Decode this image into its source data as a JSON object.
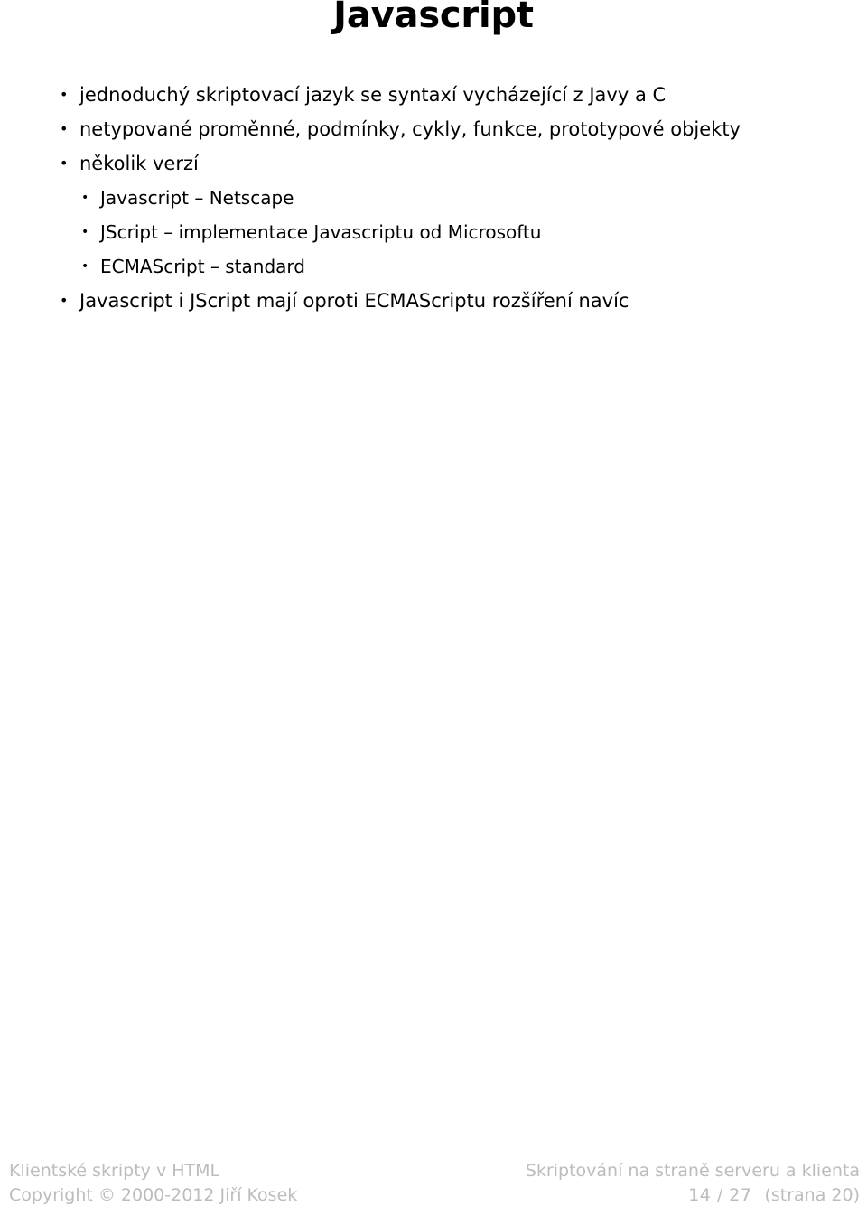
{
  "slide": {
    "title": "Javascript",
    "bullets": [
      {
        "level": 1,
        "marker": "•",
        "text": "jednoduchý skriptovací jazyk se syntaxí vycházející z Javy a C"
      },
      {
        "level": 1,
        "marker": "•",
        "text": "netypované proměnné, podmínky, cykly, funkce, prototypové objekty"
      },
      {
        "level": 1,
        "marker": "•",
        "text": "několik verzí"
      },
      {
        "level": 2,
        "marker": "•",
        "text": "Javascript – Netscape"
      },
      {
        "level": 2,
        "marker": "•",
        "text": "JScript – implementace Javascriptu od Microsoftu"
      },
      {
        "level": 2,
        "marker": "•",
        "text": "ECMAScript – standard"
      },
      {
        "level": 1,
        "marker": "•",
        "text": "Javascript i JScript mají oproti ECMAScriptu rozšíření navíc"
      }
    ]
  },
  "footer": {
    "left_line1": "Klientské skripty v HTML",
    "left_line2": "Copyright © 2000-2012 Jiří Kosek",
    "right_line1": "Skriptování na straně serveru a klienta",
    "right_page": "14 / 27",
    "right_strana": "(strana 20)",
    "text_color": "#bcbcbc"
  },
  "colors": {
    "background": "#ffffff",
    "text": "#000000",
    "footer": "#bcbcbc"
  }
}
